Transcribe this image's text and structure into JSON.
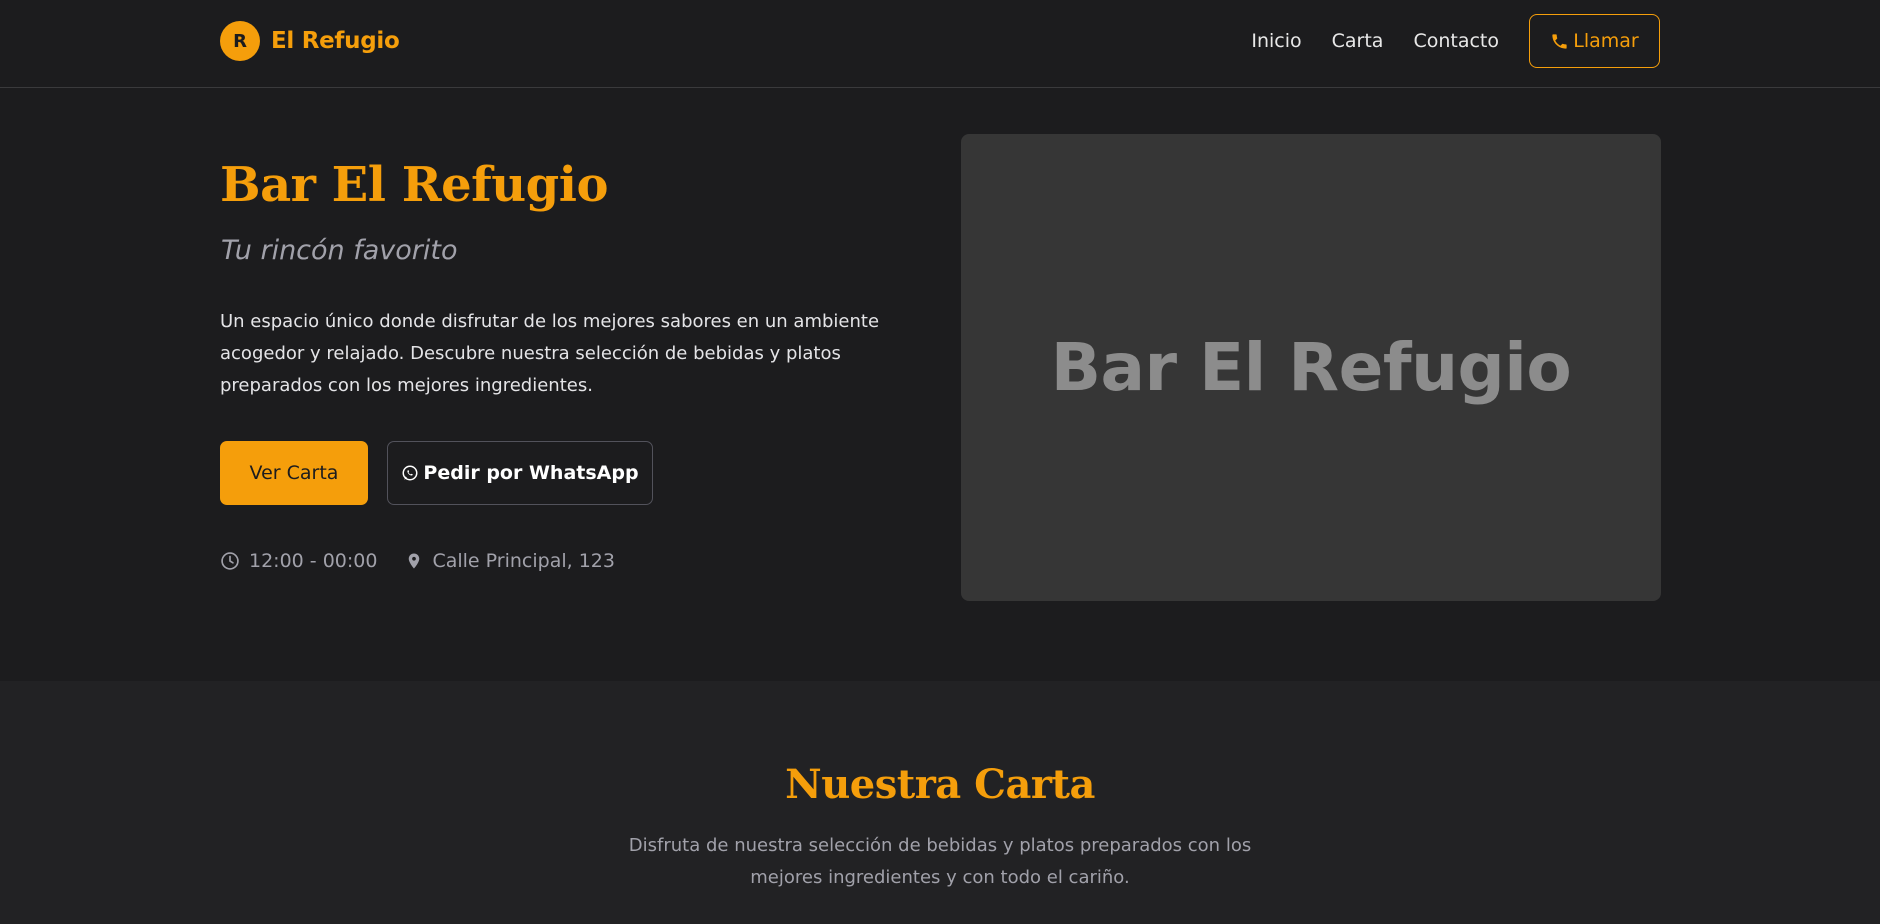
{
  "colors": {
    "accent": "#f59e0b",
    "background": "#1c1c1e",
    "section_background": "#222224",
    "muted_text": "#a1a1aa",
    "placeholder_bg": "#363636"
  },
  "nav": {
    "logo_letter": "R",
    "brand_name": "El Refugio",
    "links": [
      "Inicio",
      "Carta",
      "Contacto"
    ],
    "call_label": "Llamar",
    "call_icon": "phone-icon"
  },
  "hero": {
    "title": "Bar El Refugio",
    "subtitle": "Tu rincón favorito",
    "description": "Un espacio único donde disfrutar de los mejores sabores en un ambiente acogedor y relajado. Descubre nuestra selección de bebidas y platos preparados con los mejores ingredientes.",
    "primary_button": "Ver Carta",
    "secondary_button": "Pedir por WhatsApp",
    "secondary_icon": "whatsapp-icon",
    "hours": "12:00 - 00:00",
    "hours_icon": "clock-icon",
    "address": "Calle Principal, 123",
    "address_icon": "map-pin-icon",
    "image_text": "Bar El Refugio"
  },
  "menu": {
    "title": "Nuestra Carta",
    "description": "Disfruta de nuestra selección de bebidas y platos preparados con los mejores ingredientes y con todo el cariño."
  }
}
